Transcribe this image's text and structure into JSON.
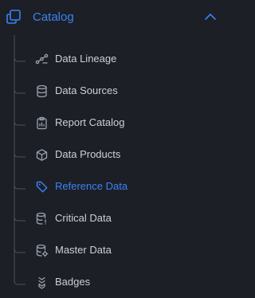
{
  "section": {
    "title": "Catalog",
    "icon": "copy-icon",
    "expanded": true,
    "accent_color": "#3b82f6"
  },
  "items": [
    {
      "label": "Data Lineage",
      "icon": "lineage-icon",
      "active": false
    },
    {
      "label": "Data Sources",
      "icon": "database-icon",
      "active": false
    },
    {
      "label": "Report Catalog",
      "icon": "clipboard-icon",
      "active": false
    },
    {
      "label": "Data Products",
      "icon": "box-icon",
      "active": false
    },
    {
      "label": "Reference Data",
      "icon": "tag-icon",
      "active": true
    },
    {
      "label": "Critical Data",
      "icon": "database-alert-icon",
      "active": false
    },
    {
      "label": "Master Data",
      "icon": "database-settings-icon",
      "active": false
    },
    {
      "label": "Badges",
      "icon": "chevrons-stack-icon",
      "active": false
    }
  ],
  "colors": {
    "background": "#1c1f26",
    "text": "#cbd0d8",
    "icon": "#9aa1ad",
    "tree_line": "#4b505a",
    "accent": "#3b82f6"
  }
}
